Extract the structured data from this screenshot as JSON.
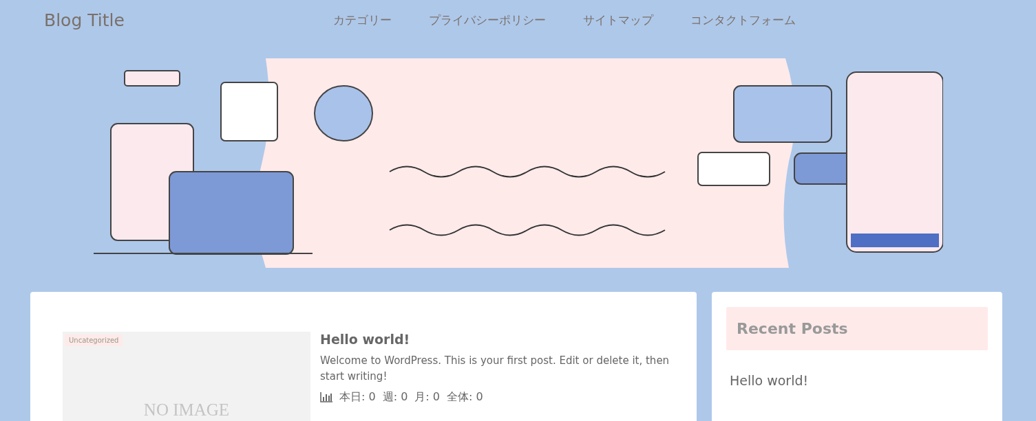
{
  "header": {
    "site_title": "Blog Title",
    "nav": [
      "カテゴリー",
      "プライバシーポリシー",
      "サイトマップ",
      "コンタクトフォーム"
    ]
  },
  "posts": [
    {
      "category": "Uncategorized",
      "thumbnail_text": "NO IMAGE",
      "title": "Hello world!",
      "excerpt": "Welcome to WordPress. This is your first post. Edit or delete it, then start writing!",
      "stats": [
        "本日: 0",
        "週: 0",
        "月: 0",
        "全体: 0"
      ]
    }
  ],
  "sidebar": {
    "widget_title": "Recent Posts",
    "items": [
      "Hello world!"
    ]
  }
}
